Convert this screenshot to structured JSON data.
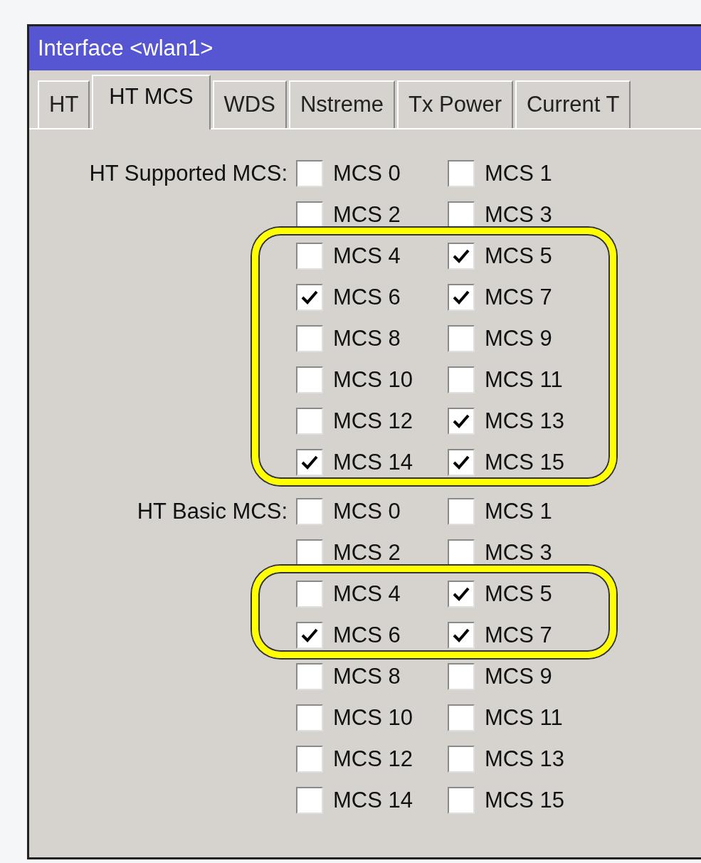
{
  "window": {
    "title": "Interface <wlan1>"
  },
  "tabs": [
    {
      "label": "HT",
      "selected": false
    },
    {
      "label": "HT MCS",
      "selected": true
    },
    {
      "label": "WDS",
      "selected": false
    },
    {
      "label": "Nstreme",
      "selected": false
    },
    {
      "label": "Tx Power",
      "selected": false
    },
    {
      "label": "Current T",
      "selected": false
    }
  ],
  "sections": [
    {
      "label": "HT Supported MCS:",
      "groups": [
        {
          "highlighted": false,
          "rows": [
            [
              {
                "label": "MCS 0",
                "checked": false
              },
              {
                "label": "MCS 1",
                "checked": false
              }
            ],
            [
              {
                "label": "MCS 2",
                "checked": false
              },
              {
                "label": "MCS 3",
                "checked": false
              }
            ]
          ]
        },
        {
          "highlighted": true,
          "rows": [
            [
              {
                "label": "MCS 4",
                "checked": false
              },
              {
                "label": "MCS 5",
                "checked": true
              }
            ],
            [
              {
                "label": "MCS 6",
                "checked": true
              },
              {
                "label": "MCS 7",
                "checked": true
              }
            ],
            [
              {
                "label": "MCS 8",
                "checked": false
              },
              {
                "label": "MCS 9",
                "checked": false
              }
            ],
            [
              {
                "label": "MCS 10",
                "checked": false
              },
              {
                "label": "MCS 11",
                "checked": false
              }
            ],
            [
              {
                "label": "MCS 12",
                "checked": false
              },
              {
                "label": "MCS 13",
                "checked": true
              }
            ],
            [
              {
                "label": "MCS 14",
                "checked": true
              },
              {
                "label": "MCS 15",
                "checked": true
              }
            ]
          ]
        }
      ]
    },
    {
      "label": "HT Basic MCS:",
      "groups": [
        {
          "highlighted": false,
          "rows": [
            [
              {
                "label": "MCS 0",
                "checked": false
              },
              {
                "label": "MCS 1",
                "checked": false
              }
            ],
            [
              {
                "label": "MCS 2",
                "checked": false
              },
              {
                "label": "MCS 3",
                "checked": false
              }
            ]
          ]
        },
        {
          "highlighted": true,
          "rows": [
            [
              {
                "label": "MCS 4",
                "checked": false
              },
              {
                "label": "MCS 5",
                "checked": true
              }
            ],
            [
              {
                "label": "MCS 6",
                "checked": true
              },
              {
                "label": "MCS 7",
                "checked": true
              }
            ]
          ]
        },
        {
          "highlighted": false,
          "rows": [
            [
              {
                "label": "MCS 8",
                "checked": false
              },
              {
                "label": "MCS 9",
                "checked": false
              }
            ],
            [
              {
                "label": "MCS 10",
                "checked": false
              },
              {
                "label": "MCS 11",
                "checked": false
              }
            ],
            [
              {
                "label": "MCS 12",
                "checked": false
              },
              {
                "label": "MCS 13",
                "checked": false
              }
            ],
            [
              {
                "label": "MCS 14",
                "checked": false
              },
              {
                "label": "MCS 15",
                "checked": false
              }
            ]
          ]
        }
      ]
    }
  ]
}
